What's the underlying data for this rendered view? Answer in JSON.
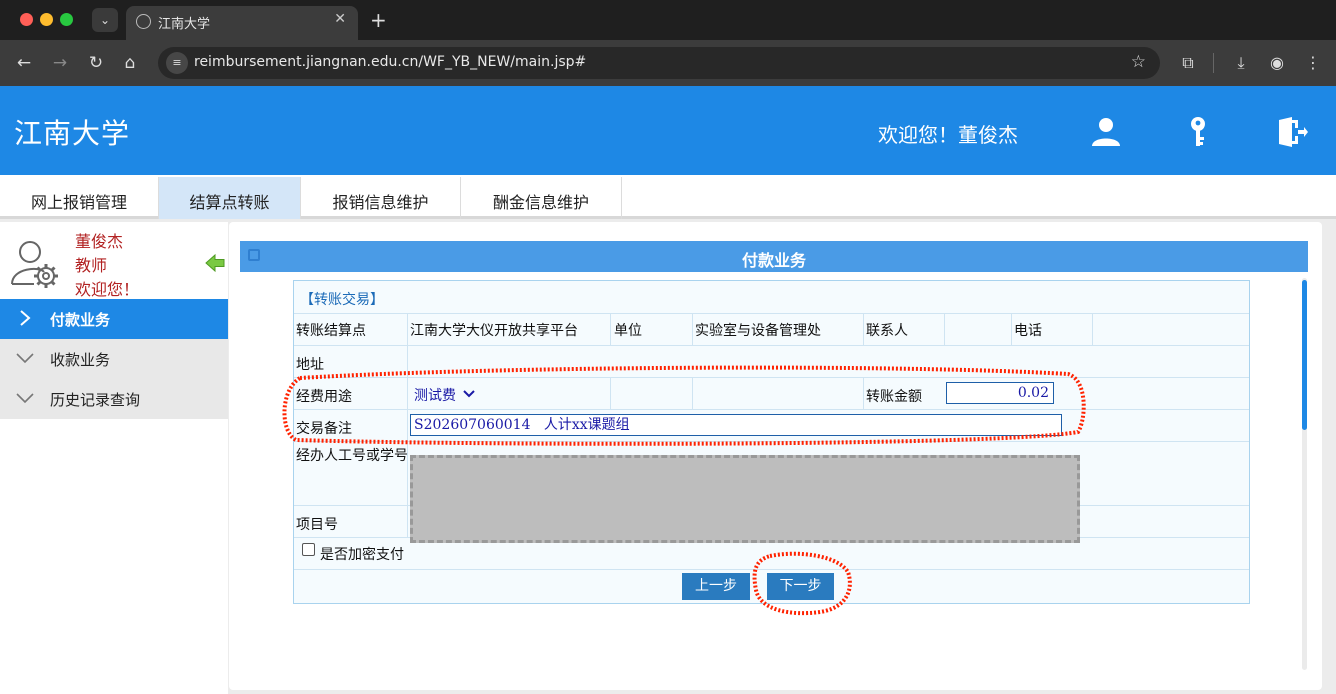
{
  "browser": {
    "tab_title": "江南大学",
    "url": "reimbursement.jiangnan.edu.cn/WF_YB_NEW/main.jsp#"
  },
  "header": {
    "title": "江南大学",
    "welcome": "欢迎您！董俊杰",
    "icons": [
      "user-icon",
      "key-icon",
      "logout-icon"
    ],
    "brand_color": "#1e88e5"
  },
  "menu": {
    "tabs": [
      {
        "label": "网上报销管理",
        "active": false
      },
      {
        "label": "结算点转账",
        "active": true
      },
      {
        "label": "报销信息维护",
        "active": false
      },
      {
        "label": "酬金信息维护",
        "active": false
      }
    ]
  },
  "sidebar": {
    "user": {
      "name": "董俊杰",
      "role": "教师",
      "greeting": "欢迎您！"
    },
    "items": [
      {
        "label": "付款业务",
        "active": true
      },
      {
        "label": "收款业务",
        "active": false
      },
      {
        "label": "历史记录查询",
        "active": false
      }
    ]
  },
  "panel": {
    "title": "付款业务",
    "section": "【转账交易】",
    "row1": {
      "label_point": "转账结算点",
      "point_value": "江南大学大仪开放共享平台",
      "label_unit": "单位",
      "unit_value": "实验室与设备管理处",
      "label_contact": "联系人",
      "contact_value": "",
      "label_phone": "电话",
      "phone_value": ""
    },
    "row2": {
      "label_address": "地址",
      "address_value": ""
    },
    "row3": {
      "label_purpose": "经费用途",
      "purpose_value": "测试费",
      "label_amount": "转账金额",
      "amount_value": "0.02"
    },
    "row4": {
      "label_memo": "交易备注",
      "memo_value": "S202607060014   人计xx课题组"
    },
    "row5": {
      "label_handler": "经办人工号或学号"
    },
    "row6": {
      "label_project": "项目号"
    },
    "row7": {
      "label_encrypt": "是否加密支付",
      "encrypt_checked": false
    },
    "buttons": {
      "prev": "上一步",
      "next": "下一步"
    }
  }
}
